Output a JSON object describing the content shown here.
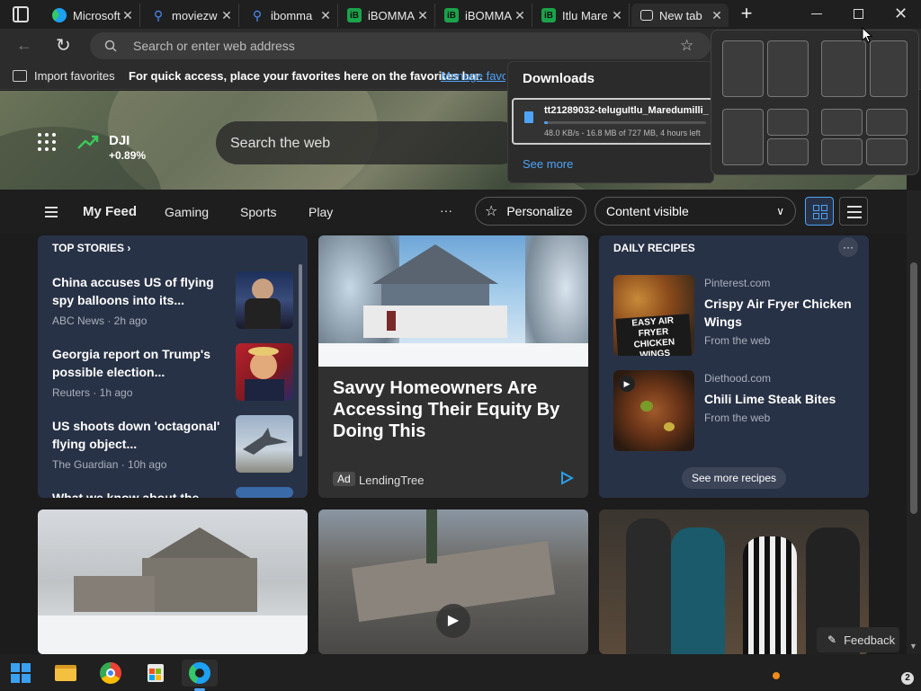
{
  "tabs": [
    {
      "label": "Microsoft",
      "icon": "edge-icon",
      "color": "#1da1f2"
    },
    {
      "label": "moviezw",
      "icon": "search-icon",
      "color": "#4c8bf5"
    },
    {
      "label": "ibomma",
      "icon": "search-icon",
      "color": "#4c8bf5"
    },
    {
      "label": "iBOMMA",
      "icon": "ibomma-icon",
      "color": "#1aa34a"
    },
    {
      "label": "iBOMMA",
      "icon": "ibomma-icon",
      "color": "#1aa34a"
    },
    {
      "label": "Itlu Mare",
      "icon": "ibomma-icon",
      "color": "#1aa34a"
    },
    {
      "label": "New tab",
      "icon": "newtab-icon",
      "color": "#ffffff"
    }
  ],
  "address": {
    "placeholder": "Search or enter web address"
  },
  "favbar": {
    "import_label": "Import favorites",
    "hint": "For quick access, place your favorites here on the favorites bar.",
    "manage_label": "Manage favori"
  },
  "hero": {
    "ticker": "DJI",
    "change": "+0.89%",
    "search_placeholder": "Search the web"
  },
  "feednav": {
    "items": [
      "My Feed",
      "Gaming",
      "Sports",
      "Play"
    ],
    "more": "···",
    "personalize": "Personalize",
    "content_visible": "Content visible"
  },
  "top_stories": {
    "header": "TOP STORIES",
    "items": [
      {
        "title": "China accuses US of flying spy balloons into its...",
        "meta": "ABC News · 2h ago"
      },
      {
        "title": "Georgia report on Trump's possible election...",
        "meta": "Reuters · 1h ago"
      },
      {
        "title": "US shoots down 'octagonal' flying object...",
        "meta": "The Guardian · 10h ago"
      },
      {
        "title": "What we know about the",
        "meta": ""
      }
    ]
  },
  "ad": {
    "title": "Savvy Homeowners Are Accessing Their Equity By Doing This",
    "badge": "Ad",
    "sponsor": "LendingTree"
  },
  "recipes": {
    "header": "DAILY RECIPES",
    "more": "···",
    "items": [
      {
        "source": "Pinterest.com",
        "title": "Crispy Air Fryer Chicken Wings",
        "meta": "From the web",
        "overlay": "EASY AIR FRYER CHICKEN WINGS"
      },
      {
        "source": "Diethood.com",
        "title": "Chili Lime Steak Bites",
        "meta": "From the web"
      }
    ],
    "see_more": "See more recipes"
  },
  "downloads": {
    "title": "Downloads",
    "file": "tt21289032-teluguItlu_Maredumilli_",
    "status": "48.0 KB/s - 16.8 MB of 727 MB, 4 hours left",
    "progress": 0.023,
    "see_more": "See more"
  },
  "feedback": {
    "label": "Feedback"
  },
  "taskbar": {
    "badge": "2"
  }
}
